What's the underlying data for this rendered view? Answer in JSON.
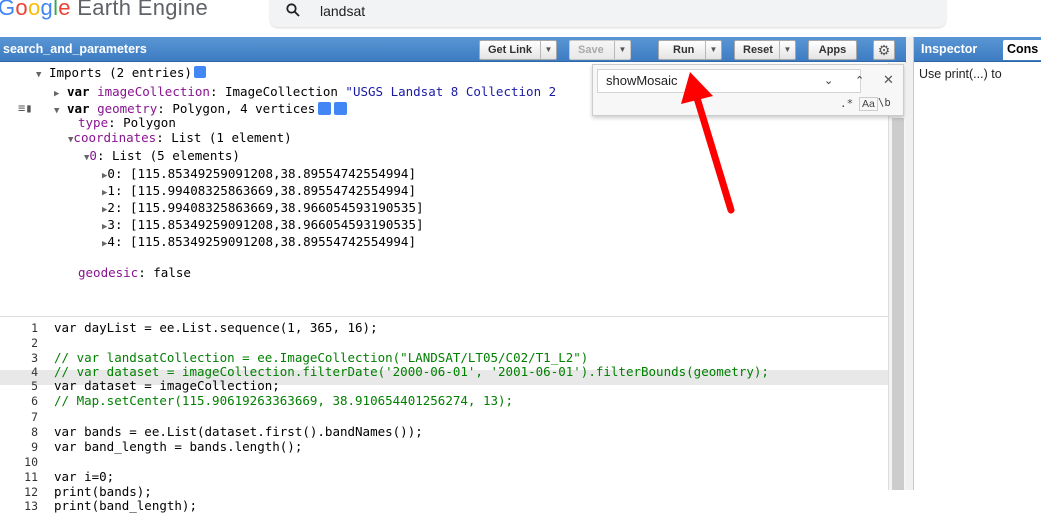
{
  "app": {
    "logo_parts": [
      "G",
      "o",
      "o",
      "g",
      "l",
      "e"
    ],
    "logo_rest": " Earth Engine",
    "search_value": "landsat"
  },
  "editor": {
    "title": "search_and_parameters",
    "buttons": {
      "get_link": "Get Link",
      "save": "Save",
      "run": "Run",
      "reset": "Reset",
      "apps": "Apps"
    },
    "imports": {
      "summary": "Imports (2 entries)",
      "line1_kw": "var",
      "line1_name": "imageCollection",
      "line1_type": ": ImageCollection ",
      "line1_value": "\"USGS Landsat 8 Collection 2",
      "line2_kw": "var",
      "line2_name": "geometry",
      "line2_type": ": Polygon, 4 vertices",
      "type_key": "type",
      "type_val": ": Polygon",
      "coords_key": "coordinates",
      "coords_val": ": List (1 element)",
      "list_key": "0",
      "list_val": ": List (5 elements)",
      "points": [
        "0: [115.85349259091208,38.89554742554994]",
        "1: [115.99408325863669,38.89554742554994]",
        "2: [115.99408325863669,38.966054593190535]",
        "3: [115.85349259091208,38.966054593190535]",
        "4: [115.85349259091208,38.89554742554994]"
      ],
      "geodesic_key": "geodesic",
      "geodesic_val": ": false"
    },
    "line_numbers": [
      "1",
      "2",
      "3",
      "4",
      "5",
      "6",
      "7",
      "8",
      "9",
      "10",
      "11",
      "12",
      "13"
    ],
    "code": [
      "var dayList = ee.List.sequence(1, 365, 16);",
      "",
      "// var landsatCollection = ee.ImageCollection(\"LANDSAT/LT05/C02/T1_L2\")",
      "// var dataset = imageCollection.filterDate('2000-06-01', '2001-06-01').filterBounds(geometry);",
      "var dataset = imageCollection;",
      "// Map.setCenter(115.90619263363669, 38.910654401256274, 13);",
      "",
      "var bands = ee.List(dataset.first().bandNames());",
      "var band_length = bands.length();",
      "",
      "var i=0;",
      "print(bands);",
      "print(band_length);"
    ],
    "find": {
      "value": "showMosaic",
      "regex_label": ".*",
      "case_label": "Aa",
      "word_label": "\\b"
    }
  },
  "right": {
    "tab_inspector": "Inspector",
    "tab_console": "Cons",
    "hint": "Use print(...) to"
  },
  "colors": {
    "header_blue": "#4a8acb",
    "annotation_arrow": "#ff0000"
  }
}
